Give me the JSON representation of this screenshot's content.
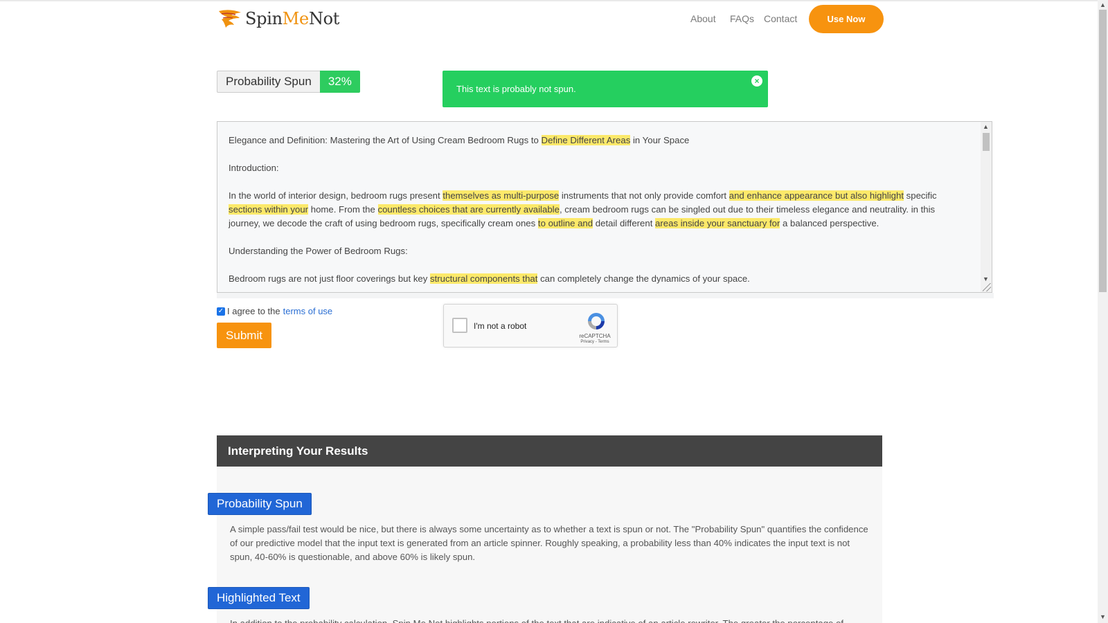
{
  "header": {
    "brand_prefix": "Spin",
    "brand_middle": "Me",
    "brand_suffix": "Not",
    "nav": [
      "About",
      "FAQs",
      "Contact"
    ],
    "cta": "Use Now"
  },
  "probability": {
    "label": "Probability Spun",
    "value": "32%"
  },
  "alert": {
    "message": "This text is probably not spun.",
    "close": "×"
  },
  "text_input": {
    "p1": [
      "Elegance and Definition: Mastering the Art of Using Cream Bedroom Rugs to ",
      "Define Different Areas",
      " in Your Space"
    ],
    "p2": "Introduction:",
    "p3": [
      "In the world of interior design, bedroom rugs present ",
      "themselves as multi-purpose",
      " instruments that not only provide comfort ",
      "and enhance appearance but also highlight",
      " specific ",
      "sections within your",
      " home. From the ",
      "countless choices that are currently available",
      ", cream bedroom rugs can be singled out due to their timeless elegance and neutrality. in this journey, we decode the craft of using bedroom rugs, specifically cream ones ",
      "to outline and",
      " detail different ",
      "areas inside your sanctuary for",
      " a balanced perspective."
    ],
    "p4": "Understanding the Power of Bedroom Rugs:",
    "p5": [
      "Bedroom rugs are not just floor coverings but key ",
      "structural components that",
      " can completely change the dynamics of your space."
    ]
  },
  "agree": {
    "prefix": "I agree to the",
    "link": "terms of use",
    "checked": true
  },
  "submit_label": "Submit",
  "recaptcha": {
    "label": "I'm not a robot",
    "brand": "reCAPTCHA",
    "links": "Privacy - Terms"
  },
  "results": {
    "title": "Interpreting Your Results",
    "sections": [
      {
        "heading": "Probability Spun",
        "body": "A simple pass/fail test would be nice, but there is always some uncertainty as to whether a text is spun or not. The \"Probability Spun\" quantifies the confidence of our predictive model that the input text is generated from an article spinner. Roughly speaking, a probability less than 40% indicates the input text is not spun, 40-60% is questionable, and above 60% is likely spun."
      },
      {
        "heading": "Highlighted Text",
        "body": "In addition to the probability calculation, Spin Me Not highlights portions of the text that are indicative of an article rewriter. The greater the percentage of"
      }
    ]
  },
  "colors": {
    "accent": "#f7930f",
    "success": "#2ecc5f",
    "highlight": "#fce96a",
    "pill": "#2166d6",
    "header_dark": "#444444"
  }
}
